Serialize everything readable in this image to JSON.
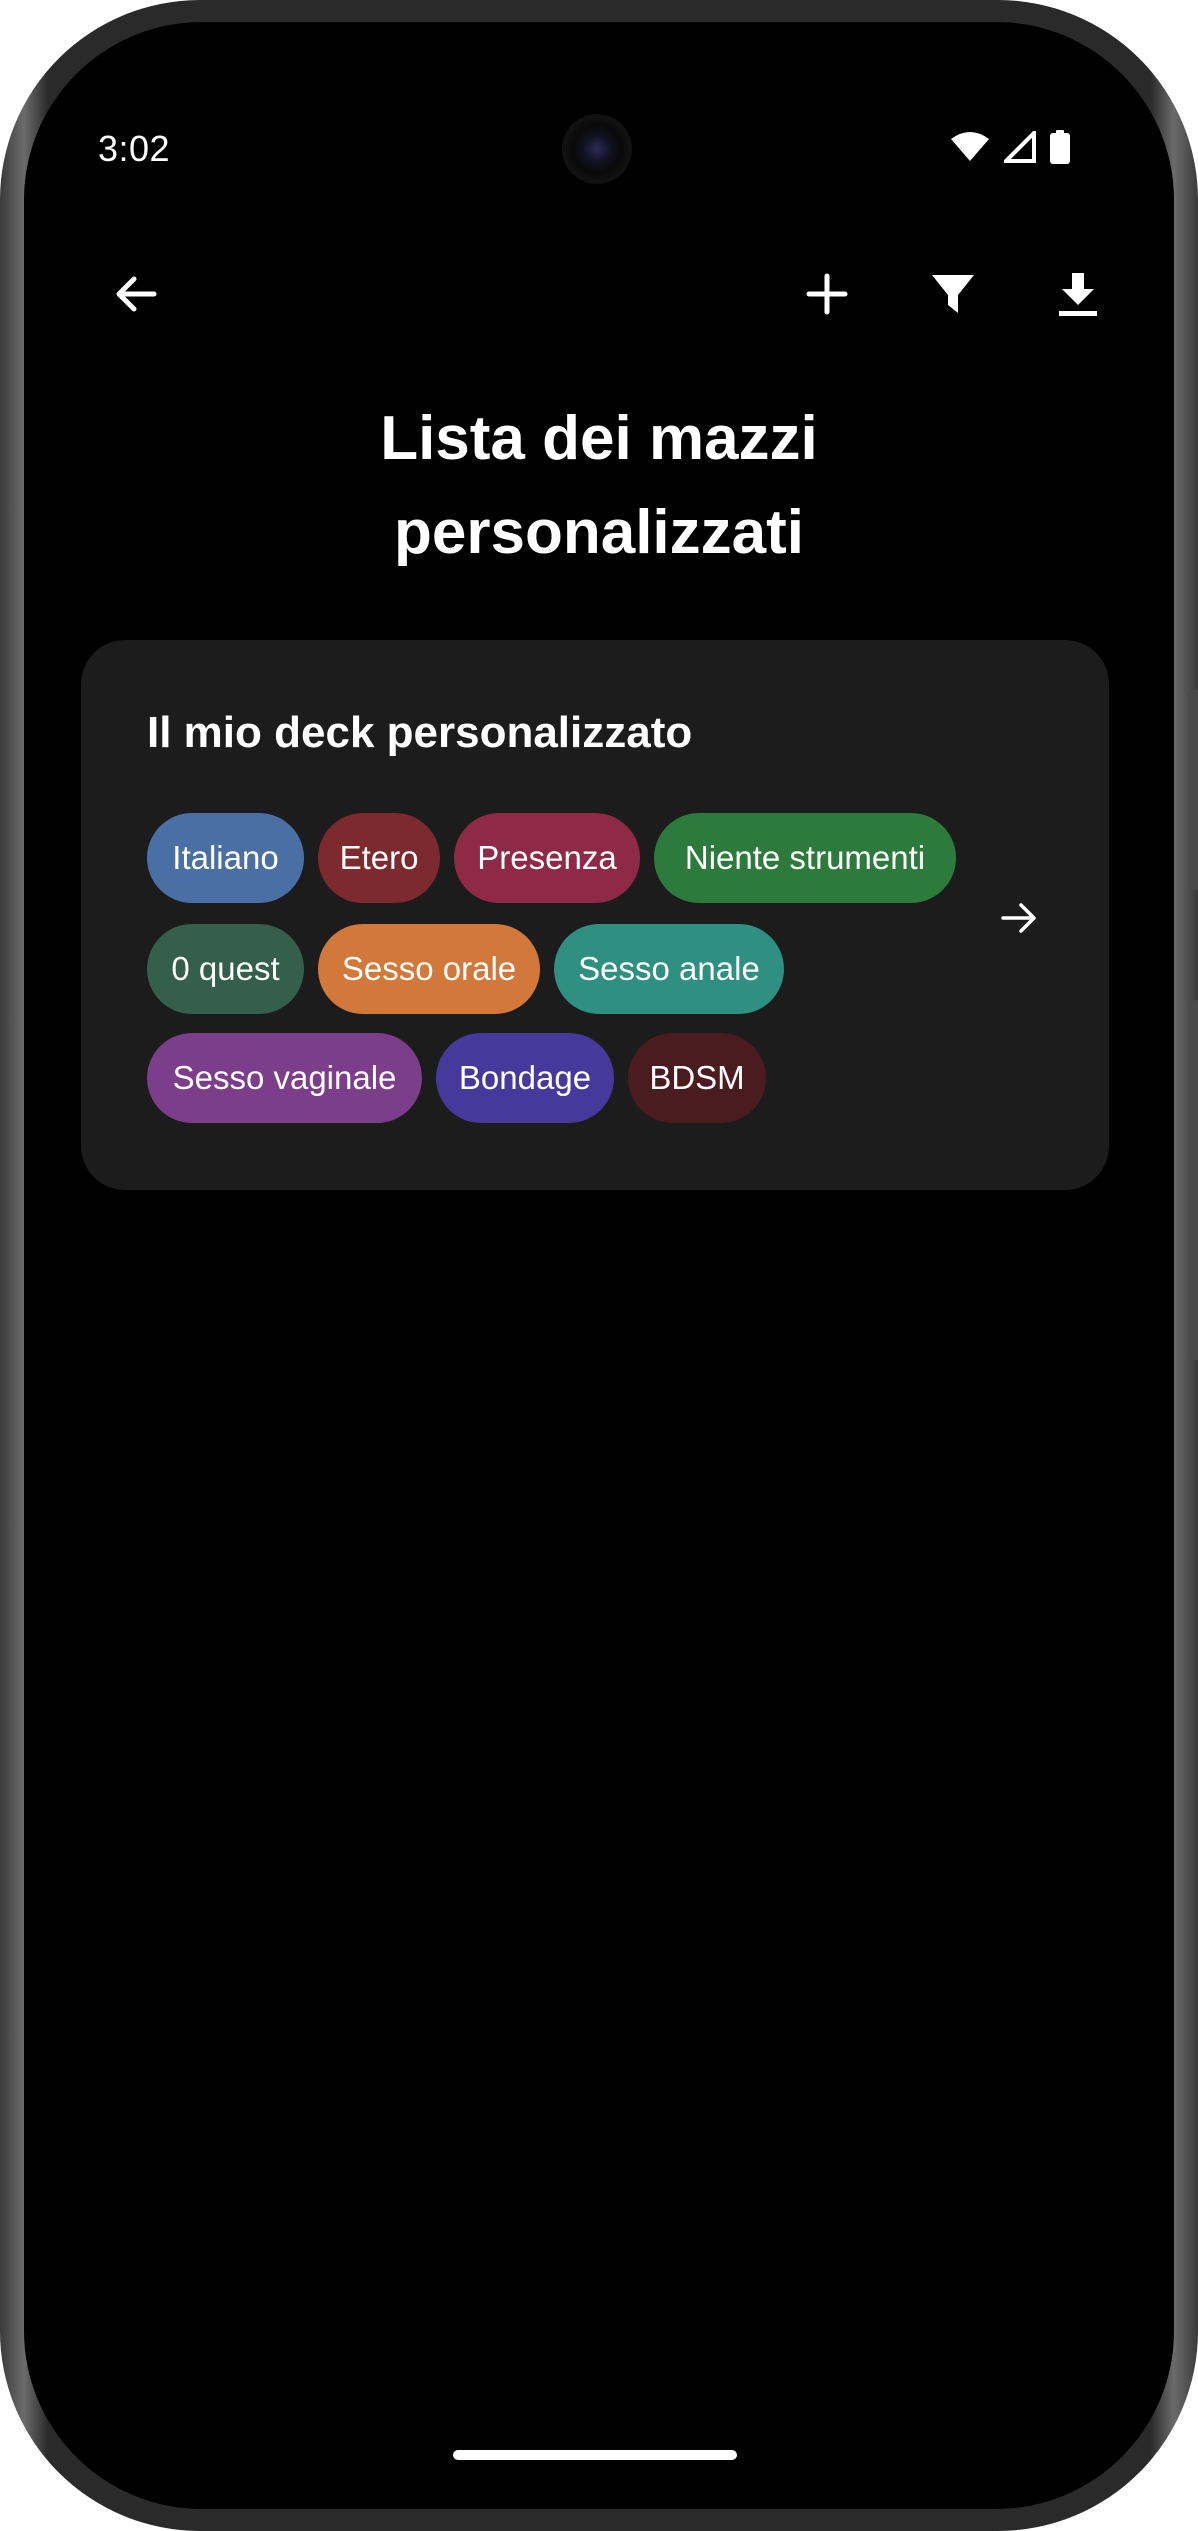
{
  "status_bar": {
    "time": "3:02",
    "icons": [
      "wifi-icon",
      "cellular-signal-icon",
      "battery-icon"
    ]
  },
  "toolbar": {
    "back_icon": "arrow-left-icon",
    "add_icon": "plus-icon",
    "filter_icon": "filter-icon",
    "download_icon": "download-icon"
  },
  "page": {
    "title_line1": "Lista dei mazzi",
    "title_line2": "personalizzati"
  },
  "decks": [
    {
      "name": "Il mio deck personalizzato",
      "open_icon": "arrow-right-icon",
      "tags": [
        {
          "label": "Italiano",
          "color": "#4a6fa5"
        },
        {
          "label": "Etero",
          "color": "#7d2a2e"
        },
        {
          "label": "Presenza",
          "color": "#8e2a48"
        },
        {
          "label": "Niente strumenti",
          "color": "#2c7a3c"
        },
        {
          "label": "0 quest",
          "color": "#345f4c"
        },
        {
          "label": "Sesso orale",
          "color": "#d2783a"
        },
        {
          "label": "Sesso anale",
          "color": "#2f8f80"
        },
        {
          "label": "Sesso vaginale",
          "color": "#7c3d8a"
        },
        {
          "label": "Bondage",
          "color": "#47389c"
        },
        {
          "label": "BDSM",
          "color": "#4a1c1f"
        }
      ]
    }
  ]
}
